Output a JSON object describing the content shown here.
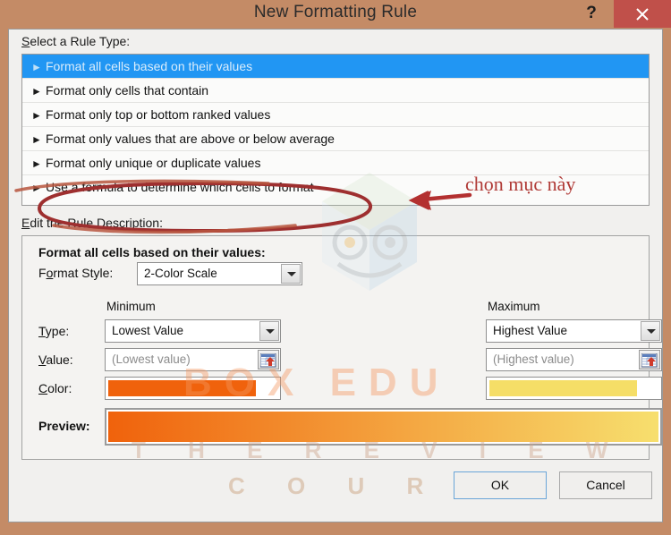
{
  "window": {
    "title": "New Formatting Rule",
    "help_label": "?",
    "close_label": "✕",
    "titlebar_color": "#c48b66",
    "close_button_color": "#c0504a"
  },
  "rule_type_section": {
    "label": "Select a Rule Type:",
    "items": [
      {
        "bullet": "►",
        "label": "Format all cells based on their values",
        "selected": true
      },
      {
        "bullet": "►",
        "label": "Format only cells that contain",
        "selected": false
      },
      {
        "bullet": "►",
        "label": "Format only top or bottom ranked values",
        "selected": false
      },
      {
        "bullet": "►",
        "label": "Format only values that are above or below average",
        "selected": false
      },
      {
        "bullet": "►",
        "label": "Format only unique or duplicate values",
        "selected": false
      },
      {
        "bullet": "►",
        "label": "Use a formula to determine which cells to format",
        "selected": false
      }
    ],
    "selection_color": "#2196f3"
  },
  "rule_description_section": {
    "label": "Edit the Rule Description:",
    "heading": "Format all cells based on their values:",
    "format_style": {
      "label": "Format Style:",
      "value": "2-Color Scale"
    },
    "columns": {
      "minimum_header": "Minimum",
      "maximum_header": "Maximum"
    },
    "rows": {
      "type_label": "Type:",
      "value_label": "Value:",
      "color_label": "Color:",
      "preview_label": "Preview:"
    },
    "minimum": {
      "type": "Lowest Value",
      "value_placeholder": "(Lowest value)",
      "color": "#f0620c"
    },
    "maximum": {
      "type": "Highest Value",
      "value_placeholder": "(Highest value)",
      "color": "#f5de67"
    },
    "preview": {
      "gradient_start": "#f0620c",
      "gradient_end": "#f7df6e"
    }
  },
  "buttons": {
    "ok": "OK",
    "cancel": "Cancel"
  },
  "annotation": {
    "text": "chọn mục này",
    "color": "#b03a36"
  },
  "watermark": {
    "line1": "BOX EDU",
    "line2": "T H E   R E V I E W",
    "line3": "C O U R S E"
  }
}
